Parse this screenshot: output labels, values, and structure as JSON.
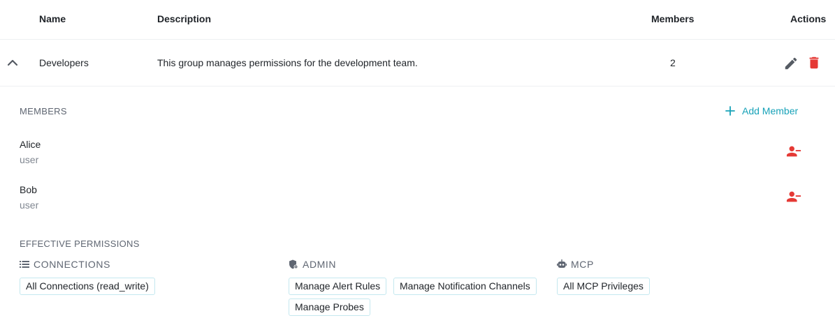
{
  "table": {
    "headers": {
      "name": "Name",
      "description": "Description",
      "members": "Members",
      "actions": "Actions"
    },
    "row": {
      "name": "Developers",
      "description": "This group manages permissions for the development team.",
      "member_count": "2",
      "edit_icon": "pencil-icon",
      "delete_icon": "trash-icon",
      "expand_icon": "chevron-up-icon"
    }
  },
  "members_section": {
    "title": "MEMBERS",
    "add_label": "Add Member",
    "add_icon": "plus-icon",
    "remove_icon": "user-remove-icon",
    "members": [
      {
        "name": "Alice",
        "role": "user"
      },
      {
        "name": "Bob",
        "role": "user"
      }
    ]
  },
  "permissions_section": {
    "title": "EFFECTIVE PERMISSIONS",
    "categories": [
      {
        "label": "CONNECTIONS",
        "icon": "list-icon",
        "chips": [
          "All Connections (read_write)"
        ]
      },
      {
        "label": "ADMIN",
        "icon": "shield-gear-icon",
        "chips": [
          "Manage Alert Rules",
          "Manage Notification Channels",
          "Manage Probes"
        ]
      },
      {
        "label": "MCP",
        "icon": "robot-icon",
        "chips": [
          "All MCP Privileges"
        ]
      }
    ]
  },
  "colors": {
    "accent": "#17a2b8",
    "danger": "#e53935",
    "icon_gray": "#555b63",
    "chip_border": "#c4e8ef"
  }
}
